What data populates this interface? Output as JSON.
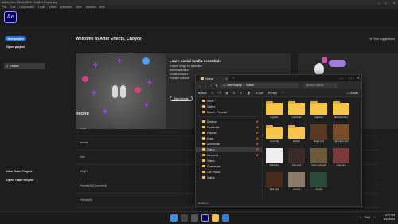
{
  "app": {
    "title": "Adobe After Effects 2024 - Untitled Project.aep",
    "logo": "Ae"
  },
  "window_controls": [
    "—",
    "☐",
    "✕"
  ],
  "menus": [
    "File",
    "Edit",
    "Composition",
    "Layer",
    "Effect",
    "Animation",
    "View",
    "Window",
    "Help"
  ],
  "left": {
    "new_project": "New project",
    "open_project": "Open project",
    "home": "Home",
    "new_team": "New Team Project",
    "open_team": "Open Team Project"
  },
  "main": {
    "welcome": "Welcome to After Effects, Choyce",
    "hide_suggestions": "Hide suggestions",
    "card": {
      "title": "Learn social media essentials",
      "lines": [
        "Explore a logo for animation",
        "Before animation",
        "Create complex r",
        "Practice advance"
      ],
      "button": "Start tutorial"
    },
    "recent_label": "Recent",
    "recent_items": [
      "crock",
      "weekle",
      "Clez",
      "RingFS",
      "Friendly00(Converted)",
      "Friendly00"
    ]
  },
  "explorer": {
    "tab_title": "Videos",
    "address": [
      "Start backup",
      "Videos"
    ],
    "search_placeholder": "Search Videos",
    "toolbar": [
      "New",
      "Sort",
      "View",
      "Details"
    ],
    "sidebar": [
      {
        "label": "Home",
        "pin": false
      },
      {
        "label": "Gallery",
        "pin": false
      },
      {
        "label": "Momin - Personal",
        "pin": false
      },
      {
        "sep": true
      },
      {
        "label": "Desktop",
        "pin": true
      },
      {
        "label": "Downloads",
        "pin": true
      },
      {
        "label": "Pictures",
        "pin": true
      },
      {
        "label": "Music",
        "pin": true
      },
      {
        "label": "Documents",
        "pin": true
      },
      {
        "label": "Videos",
        "pin": true,
        "selected": true
      },
      {
        "label": "compare1",
        "pin": true
      },
      {
        "label": "Videos",
        "pin": false
      },
      {
        "label": "Screenshots",
        "pin": false
      },
      {
        "label": "Live Photos",
        "pin": false
      },
      {
        "label": "Videos",
        "pin": false
      }
    ],
    "files": [
      {
        "name": "ImgClick",
        "kind": "folder"
      },
      {
        "name": "CacheClip",
        "kind": "folder"
      },
      {
        "name": "Captures",
        "kind": "folder"
      },
      {
        "name": "Microsoft Clipc",
        "kind": "folder"
      },
      {
        "name": "Overcraft",
        "kind": "folder"
      },
      {
        "name": "Rodobo",
        "kind": "folder"
      },
      {
        "name": "Bread.mp4",
        "kind": "video",
        "color": "#5a3a22"
      },
      {
        "name": "Clipchamp.mp4",
        "kind": "video",
        "color": "#7a4a2a"
      },
      {
        "name": "Cees.mp4",
        "kind": "video",
        "color": "#eeeeee"
      },
      {
        "name": "Cleo.mp4",
        "kind": "video",
        "color": "#3a2a2a"
      },
      {
        "name": "Comp 1(2).mp4",
        "kind": "video",
        "color": "#6a5a3a"
      },
      {
        "name": "Hops.mp4",
        "kind": "video",
        "color": "#7a3a3a"
      },
      {
        "name": "Byte.mp4",
        "kind": "video",
        "color": "#4a2a1a"
      },
      {
        "name": "cc.mp4",
        "kind": "video",
        "color": "#8a7a6a"
      },
      {
        "name": "cs.mp4",
        "kind": "video",
        "color": "#2a4a3a"
      }
    ],
    "status": "15 items  |"
  },
  "taskbar": {
    "time": "4:07 PM",
    "date": "8/12/2024",
    "tray": "ENG"
  }
}
